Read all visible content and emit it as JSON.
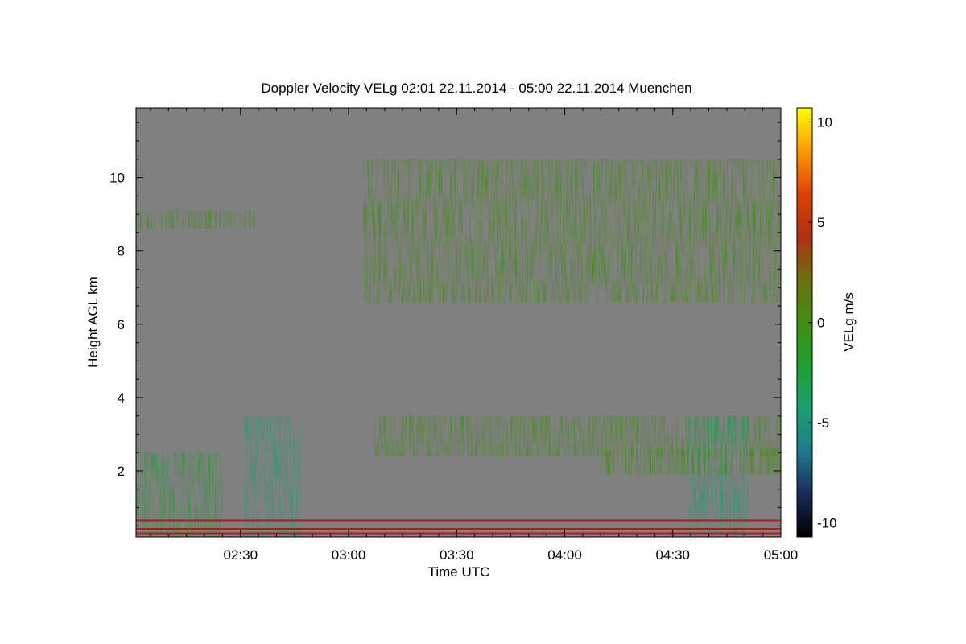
{
  "chart_data": {
    "type": "heatmap",
    "title": "Doppler Velocity VELg   02:01 22.11.2014 - 05:00 22.11.2014 Muenchen",
    "xlabel": "Time UTC",
    "ylabel": "Height AGL km",
    "colorbar_label": "VELg m/s",
    "xlim": [
      "02:01",
      "05:00"
    ],
    "ylim": [
      0.2,
      11.9
    ],
    "x_ticks": [
      "02:30",
      "03:00",
      "03:30",
      "04:00",
      "04:30",
      "05:00"
    ],
    "y_ticks": [
      2,
      4,
      6,
      8,
      10
    ],
    "colorbar_range": [
      -10.7,
      10.7
    ],
    "colorbar_ticks": [
      10,
      5,
      0,
      -5,
      -10
    ],
    "background_color": "#808080",
    "colormap": [
      "#000000",
      "#1a2a5a",
      "#1f7a8c",
      "#19a070",
      "#1fa030",
      "#3f8f10",
      "#6b7010",
      "#b03010",
      "#e04000",
      "#ff9a00",
      "#ffff00"
    ],
    "echo_regions": [
      {
        "name": "upper-cloud-left",
        "times": [
          "02:01",
          "02:34"
        ],
        "height_range": [
          8.6,
          9.1
        ],
        "velocity": -0.3
      },
      {
        "name": "upper-cloud-right",
        "times": [
          "03:04",
          "05:00"
        ],
        "height_range": [
          6.6,
          10.5
        ],
        "velocity": -0.8
      },
      {
        "name": "mid-layer",
        "times": [
          "03:07",
          "05:00"
        ],
        "height_range": [
          2.4,
          3.5
        ],
        "velocity": -0.6
      },
      {
        "name": "precip-shaft-1",
        "times": [
          "02:31",
          "02:47"
        ],
        "height_range": [
          0.2,
          3.5
        ],
        "velocity": -3.5
      },
      {
        "name": "precip-shaft-2",
        "times": [
          "04:34",
          "04:51"
        ],
        "height_range": [
          0.2,
          3.5
        ],
        "velocity": -5.0
      },
      {
        "name": "low-cloud-left",
        "times": [
          "02:01",
          "02:25"
        ],
        "height_range": [
          0.2,
          2.5
        ],
        "velocity": -2.5
      },
      {
        "name": "low-layer-right",
        "times": [
          "04:10",
          "05:00"
        ],
        "height_range": [
          1.9,
          2.6
        ],
        "velocity": -0.5
      }
    ],
    "near_ground_lines": [
      {
        "height": 0.65,
        "color": "#c81010"
      },
      {
        "height": 0.42,
        "color": "#c81010"
      },
      {
        "height": 0.3,
        "color": "#c81010"
      }
    ],
    "grid": false,
    "legend": "colorbar-right"
  }
}
